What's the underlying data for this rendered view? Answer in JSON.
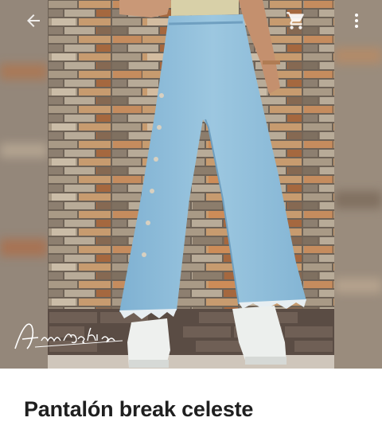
{
  "product": {
    "title": "Pantalón break celeste",
    "image": {
      "watermark_text": "Amfashion",
      "description_hidden": true
    }
  },
  "topbar": {
    "back_icon": "arrow-left-icon",
    "cart_icon": "cart-icon",
    "more_icon": "more-vertical-icon"
  },
  "colors": {
    "title": "#1f1f1f",
    "icons": "#ffffff",
    "jeans": "#8fbcd8"
  }
}
